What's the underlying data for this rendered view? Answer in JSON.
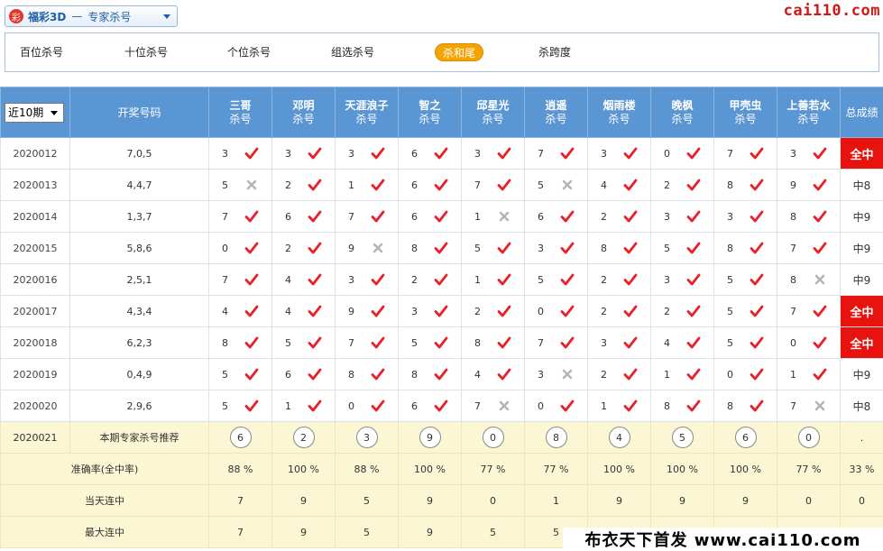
{
  "header": {
    "lottery_name": "福彩3D",
    "separator": "—",
    "mode": "专家杀号",
    "logo_glyph": "彩",
    "watermark_top": "cai110.com"
  },
  "tabs": [
    {
      "label": "百位杀号",
      "active": false
    },
    {
      "label": "十位杀号",
      "active": false
    },
    {
      "label": "个位杀号",
      "active": false
    },
    {
      "label": "组选杀号",
      "active": false
    },
    {
      "label": "杀和尾",
      "active": true
    },
    {
      "label": "杀跨度",
      "active": false
    }
  ],
  "table": {
    "period_select": "近10期",
    "col_draw": "开奖号码",
    "col_total": "总成绩",
    "sub_label": "杀号",
    "experts": [
      "三哥",
      "邓明",
      "天涯浪子",
      "智之",
      "邱星光",
      "逍遥",
      "烟雨楼",
      "晚枫",
      "甲壳虫",
      "上善若水"
    ],
    "rows": [
      {
        "issue": "2020012",
        "draw": "7,0,5",
        "kills": [
          3,
          3,
          3,
          6,
          3,
          7,
          3,
          0,
          7,
          3
        ],
        "hits": [
          1,
          1,
          1,
          1,
          1,
          1,
          1,
          1,
          1,
          1
        ],
        "total": "全中",
        "full": true
      },
      {
        "issue": "2020013",
        "draw": "4,4,7",
        "kills": [
          5,
          2,
          1,
          6,
          7,
          5,
          4,
          2,
          8,
          9
        ],
        "hits": [
          0,
          1,
          1,
          1,
          1,
          0,
          1,
          1,
          1,
          1
        ],
        "total": "中8",
        "full": false
      },
      {
        "issue": "2020014",
        "draw": "1,3,7",
        "kills": [
          7,
          6,
          7,
          6,
          1,
          6,
          2,
          3,
          3,
          8
        ],
        "hits": [
          1,
          1,
          1,
          1,
          0,
          1,
          1,
          1,
          1,
          1
        ],
        "total": "中9",
        "full": false
      },
      {
        "issue": "2020015",
        "draw": "5,8,6",
        "kills": [
          0,
          2,
          9,
          8,
          5,
          3,
          8,
          5,
          8,
          7
        ],
        "hits": [
          1,
          1,
          0,
          1,
          1,
          1,
          1,
          1,
          1,
          1
        ],
        "total": "中9",
        "full": false
      },
      {
        "issue": "2020016",
        "draw": "2,5,1",
        "kills": [
          7,
          4,
          3,
          2,
          1,
          5,
          2,
          3,
          5,
          8
        ],
        "hits": [
          1,
          1,
          1,
          1,
          1,
          1,
          1,
          1,
          1,
          0
        ],
        "total": "中9",
        "full": false
      },
      {
        "issue": "2020017",
        "draw": "4,3,4",
        "kills": [
          4,
          4,
          9,
          3,
          2,
          0,
          2,
          2,
          5,
          7
        ],
        "hits": [
          1,
          1,
          1,
          1,
          1,
          1,
          1,
          1,
          1,
          1
        ],
        "total": "全中",
        "full": true
      },
      {
        "issue": "2020018",
        "draw": "6,2,3",
        "kills": [
          8,
          5,
          7,
          5,
          8,
          7,
          3,
          4,
          5,
          0
        ],
        "hits": [
          1,
          1,
          1,
          1,
          1,
          1,
          1,
          1,
          1,
          1
        ],
        "total": "全中",
        "full": true
      },
      {
        "issue": "2020019",
        "draw": "0,4,9",
        "kills": [
          5,
          6,
          8,
          8,
          4,
          3,
          2,
          1,
          0,
          1
        ],
        "hits": [
          1,
          1,
          1,
          1,
          1,
          0,
          1,
          1,
          1,
          1
        ],
        "total": "中9",
        "full": false
      },
      {
        "issue": "2020020",
        "draw": "2,9,6",
        "kills": [
          5,
          1,
          0,
          6,
          7,
          0,
          1,
          8,
          8,
          7
        ],
        "hits": [
          1,
          1,
          1,
          1,
          0,
          1,
          1,
          1,
          1,
          0
        ],
        "total": "中8",
        "full": false
      }
    ],
    "recommend": {
      "issue": "2020021",
      "label": "本期专家杀号推荐",
      "balls": [
        6,
        2,
        3,
        9,
        0,
        8,
        4,
        5,
        6,
        0
      ],
      "total": "."
    },
    "accuracy": {
      "label": "准确率(全中率)",
      "values": [
        "88 %",
        "100 %",
        "88 %",
        "100 %",
        "77 %",
        "77 %",
        "100 %",
        "100 %",
        "100 %",
        "77 %"
      ],
      "total": "33 %"
    },
    "streak_today": {
      "label": "当天连中",
      "values": [
        "7",
        "9",
        "5",
        "9",
        "0",
        "1",
        "9",
        "9",
        "9",
        "0"
      ],
      "total": "0"
    },
    "streak_max": {
      "label": "最大连中",
      "values": [
        "7",
        "9",
        "5",
        "9",
        "5",
        "5",
        "",
        "",
        "",
        ""
      ],
      "total": ""
    }
  },
  "colors": {
    "header_blue": "#5b96d4",
    "hit_red": "#e8202a",
    "miss_gray": "#b5b5b5",
    "full_red": "#e8130f",
    "tab_active": "#f5a300"
  },
  "watermark_bottom": "布衣天下首发 www.cai110.com"
}
